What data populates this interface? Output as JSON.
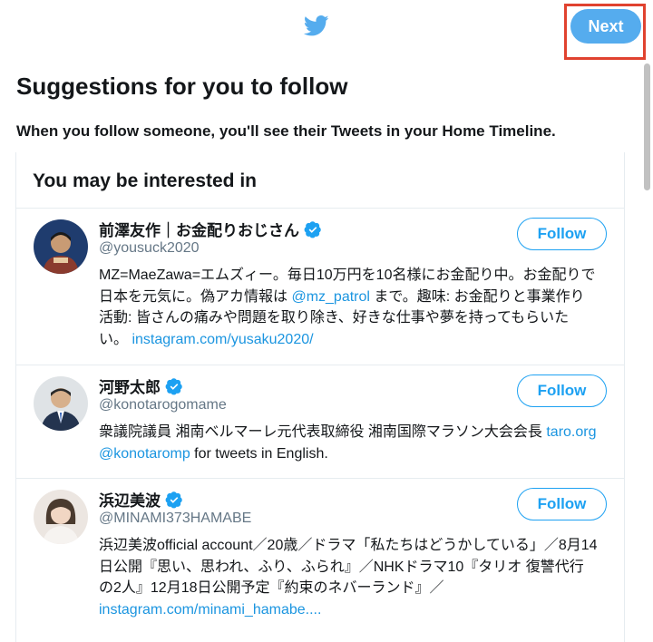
{
  "header": {
    "logo_icon": "twitter-bird-icon",
    "next_label": "Next",
    "accent_color": "#55acee",
    "highlight_color": "#e0422f"
  },
  "page": {
    "title": "Suggestions for you to follow",
    "subtitle": "When you follow someone, you'll see their Tweets in your Home Timeline."
  },
  "section": {
    "title": "You may be interested in"
  },
  "users": [
    {
      "name": "前澤友作｜お金配りおじさん",
      "handle": "@yousuck2020",
      "verified": true,
      "follow_label": "Follow",
      "bio_parts": [
        {
          "text": "MZ=MaeZawa=エムズィー。毎日10万円を10名様にお金配り中。お金配りで日本を元気に。偽アカ情報は "
        },
        {
          "text": "@mz_patrol",
          "link": true
        },
        {
          "text": " まで。趣味: お金配りと事業作り 活動: 皆さんの痛みや問題を取り除き、好きな仕事や夢を持ってもらいたい。 "
        },
        {
          "text": "instagram.com/yusaku2020/",
          "link": true
        }
      ]
    },
    {
      "name": "河野太郎",
      "handle": "@konotarogomame",
      "verified": true,
      "follow_label": "Follow",
      "bio_parts": [
        {
          "text": "衆議院議員 湘南ベルマーレ元代表取締役 湘南国際マラソン大会会長 "
        },
        {
          "text": "taro.org",
          "link": true
        },
        {
          "text": " "
        },
        {
          "text": "@konotaromp",
          "link": true
        },
        {
          "text": " for tweets in English."
        }
      ]
    },
    {
      "name": "浜辺美波",
      "handle": "@MINAMI373HAMABE",
      "verified": true,
      "follow_label": "Follow",
      "bio_parts": [
        {
          "text": "浜辺美波official account／20歳／ドラマ「私たちはどうかしている」／8月14日公開『思い、思われ、ふり、ふられ』／NHKドラマ10『タリオ 復讐代行の2人』12月18日公開予定『約束のネバーランド』／"
        },
        {
          "text": "instagram.com/minami_hamabe....",
          "link": true
        }
      ]
    }
  ]
}
